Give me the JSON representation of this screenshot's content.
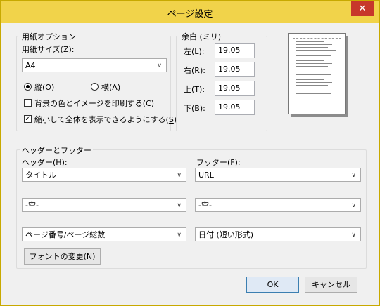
{
  "window": {
    "title": "ページ設定",
    "close_label": "✕"
  },
  "paper": {
    "group_label": "用紙オプション",
    "size_label": "用紙サイズ(Z):",
    "size_value": "A4",
    "portrait_label": "縦(O)",
    "landscape_label": "横(A)",
    "orientation": "portrait",
    "print_bg_label": "背景の色とイメージを印刷する(C)",
    "print_bg_checked": false,
    "shrink_label": "縮小して全体を表示できるようにする(S)",
    "shrink_checked": true
  },
  "margins": {
    "group_label": "余白 (ミリ)",
    "left_label": "左(L):",
    "left_value": "19.05",
    "right_label": "右(R):",
    "right_value": "19.05",
    "top_label": "上(T):",
    "top_value": "19.05",
    "bottom_label": "下(B):",
    "bottom_value": "19.05"
  },
  "header_footer": {
    "group_label": "ヘッダーとフッター",
    "header_label": "ヘッダー(H):",
    "footer_label": "フッター(F):",
    "header_values": [
      "タイトル",
      "-空-",
      "ページ番号/ページ総数"
    ],
    "footer_values": [
      "URL",
      "-空-",
      "日付 (短い形式)"
    ],
    "font_button": "フォントの変更(N)"
  },
  "buttons": {
    "ok": "OK",
    "cancel": "キャンセル"
  },
  "icons": {
    "dropdown": "chevron-down-icon",
    "close": "close-icon"
  }
}
